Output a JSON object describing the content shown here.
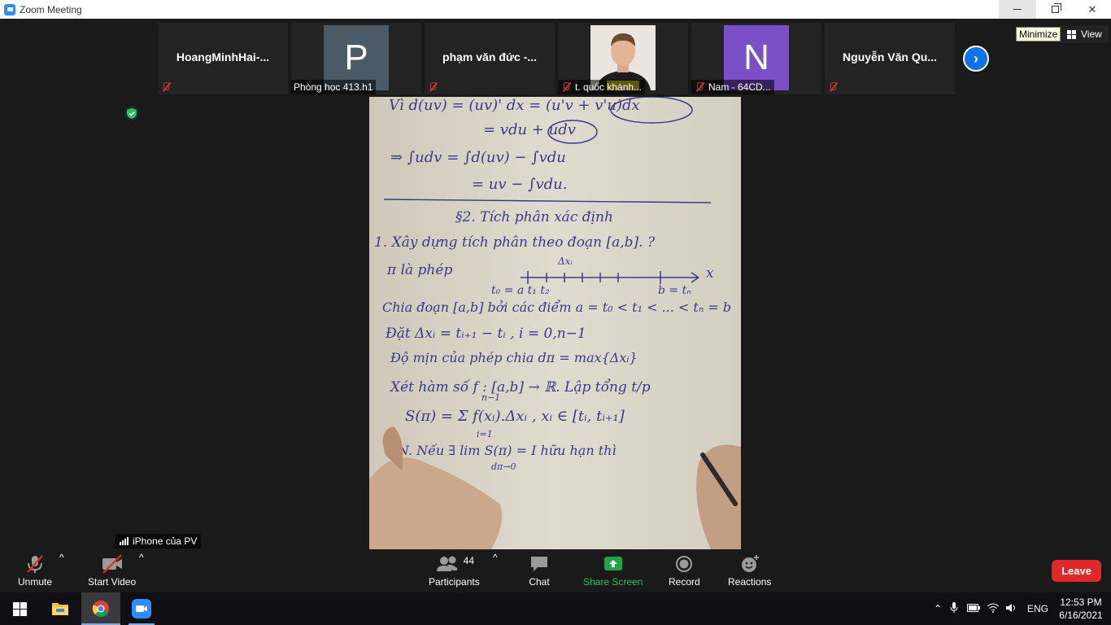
{
  "window": {
    "title": "Zoom Meeting"
  },
  "tooltip": "Minimize",
  "view_label": "View",
  "participants": [
    {
      "name": "HoangMinhHai-...",
      "kind": "name",
      "muted": true
    },
    {
      "name": "Phòng học 413.h1",
      "kind": "avatar",
      "initial": "P",
      "color": "#4a5a66",
      "muted": false
    },
    {
      "name": "phạm văn đức -...",
      "kind": "name",
      "muted": true
    },
    {
      "name": "t. quốc khánh...",
      "kind": "photo",
      "muted": true
    },
    {
      "name": "Nam - 64CD...",
      "kind": "avatar",
      "initial": "N",
      "color": "#7b4fc7",
      "muted": true
    },
    {
      "name": "Nguyễn Văn Qu...",
      "kind": "name",
      "muted": true
    }
  ],
  "sharer": "iPhone của PV",
  "notes": {
    "line1": "Vì d(uv) = (uv)' dx = (u'v + v'u)dx",
    "line2": "= vdu + udv",
    "line3": "⇒ ∫udv = ∫d(uv) − ∫vdu",
    "line4": "= uv − ∫vdu.",
    "heading": "§2. Tích phân xác định",
    "item1": "1. Xây dựng tích phân theo đoạn [a,b]. ?",
    "pi": "π là phép",
    "axis_x": "x",
    "t_left": "t₀ = a  t₁  t₂",
    "t_right": "b = tₙ",
    "dx_label": "Δxᵢ",
    "chia": "Chia đoạn [a,b] bởi các điểm a = t₀ < t₁ < ... < tₙ = b",
    "dat": "Đặt  Δxᵢ = tᵢ₊₁ − tᵢ ,  i = 0,n−1",
    "domin": "Độ mịn của phép chia dπ = max{Δxᵢ}",
    "xet": "Xét hàm số f : [a,b] → ℝ. Lập tổng t/p",
    "sum": "S(π) = Σ f(xᵢ).Δxᵢ , xᵢ ∈ [tᵢ, tᵢ₊₁]",
    "sum_top": "n−1",
    "sum_bottom": "i=1",
    "dn": "ĐN. Nếu ∃ lim S(π) = I hữu hạn thì",
    "dn_sub": "dπ→0"
  },
  "toolbar": {
    "unmute": "Unmute",
    "start_video": "Start Video",
    "participants_label": "Participants",
    "participants_count": "44",
    "chat": "Chat",
    "share_screen": "Share Screen",
    "record": "Record",
    "reactions": "Reactions",
    "leave": "Leave"
  },
  "taskbar": {
    "lang": "ENG",
    "time": "12:53 PM",
    "date": "6/16/2021"
  },
  "colors": {
    "accent": "#0e72ed",
    "share_green": "#1ea54a",
    "leave_red": "#e02828",
    "ink": "#3a3a8a"
  }
}
